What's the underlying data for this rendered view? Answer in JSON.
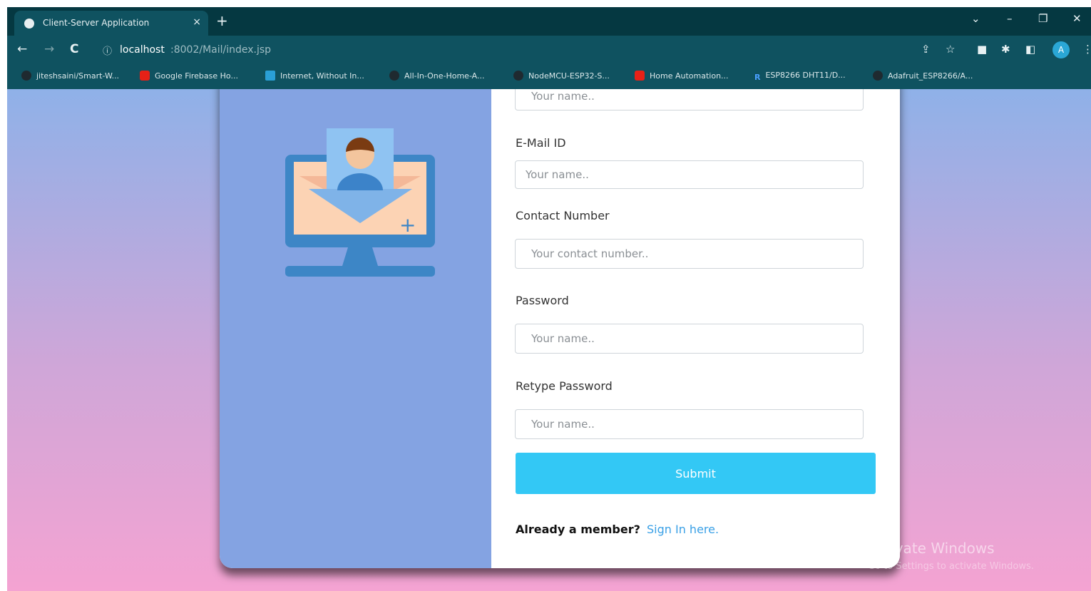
{
  "browser": {
    "tab_title": "Client-Server Application",
    "tab_close": "×",
    "new_tab": "+",
    "window_controls": [
      "⌄",
      "–",
      "❐",
      "✕"
    ],
    "nav": {
      "back": "←",
      "forward": "→",
      "reload": "C"
    },
    "address": {
      "host": "localhost",
      "path": ":8002/Mail/index.jsp",
      "info_icon": "ⓘ"
    },
    "toolbar_icons": [
      "share-icon",
      "star-icon",
      "extension-icon",
      "puzzle-icon",
      "sidepanel-icon"
    ],
    "profile_initial": "A",
    "menu": "⋮",
    "bookmarks": [
      {
        "label": "jiteshsaini/Smart-W...",
        "icon": "github-icon",
        "color": "#1f2a30"
      },
      {
        "label": "Google Firebase Ho...",
        "icon": "youtube-icon",
        "color": "#e62117"
      },
      {
        "label": "Internet, Without In...",
        "icon": "site-icon",
        "color": "#2a9fd6"
      },
      {
        "label": "All-In-One-Home-A...",
        "icon": "github-icon",
        "color": "#1f2a30"
      },
      {
        "label": "NodeMCU-ESP32-S...",
        "icon": "github-icon",
        "color": "#1f2a30"
      },
      {
        "label": "Home Automation...",
        "icon": "youtube-icon",
        "color": "#e62117"
      },
      {
        "label": "ESP8266 DHT11/D...",
        "icon": "r-icon",
        "color": "#2a7fe0"
      },
      {
        "label": "Adafruit_ESP8266/A...",
        "icon": "github-icon",
        "color": "#1f2a30"
      }
    ]
  },
  "form": {
    "name_placeholder": "Your name..",
    "email_label": "E-Mail ID",
    "email_placeholder": "Your name..",
    "contact_label": "Contact Number",
    "contact_placeholder": "Your contact number..",
    "password_label": "Password",
    "password_placeholder": "Your name..",
    "retype_label": "Retype Password",
    "retype_placeholder": "Your name..",
    "submit_label": "Submit",
    "member_question": "Already a member?",
    "signin_link": "Sign In here."
  },
  "watermark": {
    "line1": "Activate Windows",
    "line2": "Go to Settings to activate Windows."
  },
  "colors": {
    "accent": "#33c8f5",
    "panel": "#84a3e2",
    "link": "#3aa0e6"
  }
}
